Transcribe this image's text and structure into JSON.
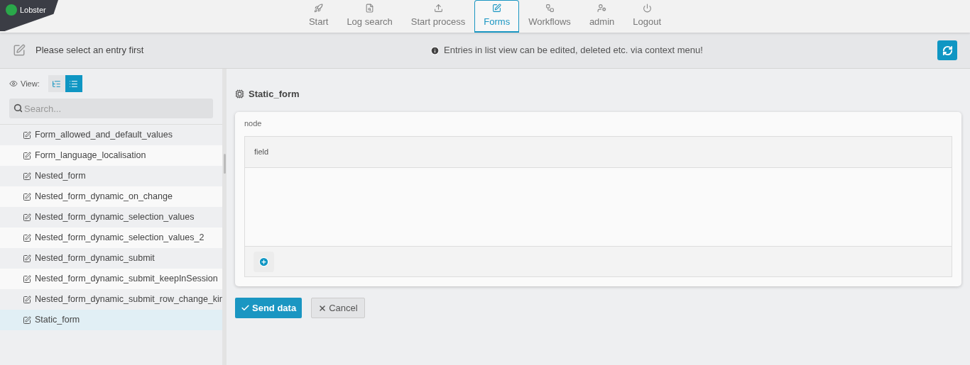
{
  "logo": {
    "text": "Lobster"
  },
  "nav": [
    {
      "label": "Start",
      "selected": false
    },
    {
      "label": "Log search",
      "selected": false
    },
    {
      "label": "Start process",
      "selected": false
    },
    {
      "label": "Forms",
      "selected": true
    },
    {
      "label": "Workflows",
      "selected": false
    },
    {
      "label": "admin",
      "selected": false
    },
    {
      "label": "Logout",
      "selected": false
    }
  ],
  "toolbar": {
    "title": "Please select an entry first",
    "hint": "Entries in list view can be edited, deleted etc. via context menu!"
  },
  "sidebar": {
    "view_label": "View:",
    "view_toggle": [
      {
        "kind": "tree",
        "selected": false
      },
      {
        "kind": "list",
        "selected": true
      }
    ],
    "search": {
      "placeholder": "Search..."
    },
    "items": [
      {
        "label": "Form_allowed_and_default_values",
        "selected": false
      },
      {
        "label": "Form_language_localisation",
        "selected": false
      },
      {
        "label": "Nested_form",
        "selected": false
      },
      {
        "label": "Nested_form_dynamic_on_change",
        "selected": false
      },
      {
        "label": "Nested_form_dynamic_selection_values",
        "selected": false
      },
      {
        "label": "Nested_form_dynamic_selection_values_2",
        "selected": false
      },
      {
        "label": "Nested_form_dynamic_submit",
        "selected": false
      },
      {
        "label": "Nested_form_dynamic_submit_keepInSession",
        "selected": false
      },
      {
        "label": "Nested_form_dynamic_submit_row_change_kin",
        "selected": false
      },
      {
        "label": "Static_form",
        "selected": true
      }
    ]
  },
  "form": {
    "title": "Static_form",
    "node_label": "node",
    "field_header": "field",
    "buttons": [
      {
        "kind": "submit",
        "label": "Send data"
      },
      {
        "kind": "cancel",
        "label": "Cancel"
      }
    ]
  }
}
